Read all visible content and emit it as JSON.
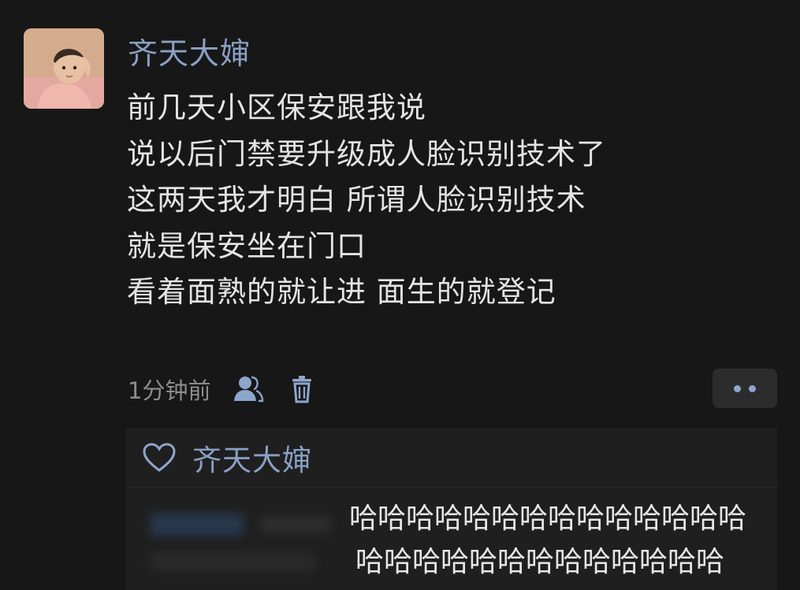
{
  "post": {
    "author": "齐天大婶",
    "lines": [
      "前几天小区保安跟我说",
      "说以后门禁要升级成人脸识别技术了",
      "这两天我才明白 所谓人脸识别技术",
      "就是保安坐在门口",
      "看着面熟的就让进 面生的就登记"
    ],
    "timestamp": "1分钟前",
    "icons": {
      "avatar": "child-photo-avatar",
      "visibility": "people-icon",
      "delete": "trash-icon",
      "more": "more-dots-icon",
      "like": "heart-icon"
    }
  },
  "likes": {
    "names": "齐天大婶"
  },
  "reply": {
    "line1": "哈哈哈哈哈哈哈哈哈哈哈哈哈哈",
    "line2": "哈哈哈哈哈哈哈哈哈哈哈哈哈"
  },
  "colors": {
    "background": "#171717",
    "name_link": "#8aa0c4",
    "text": "#e4e4e4",
    "muted": "#8d8d8d",
    "panel": "#1f1f1f"
  }
}
